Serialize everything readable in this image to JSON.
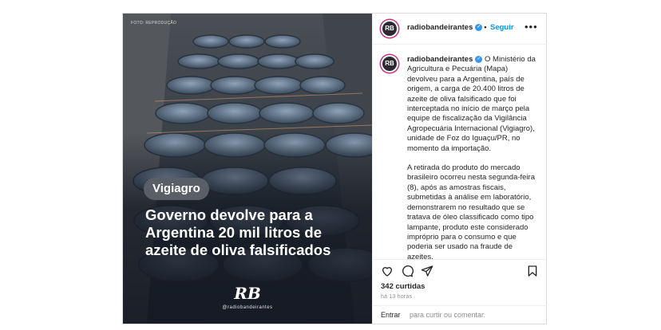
{
  "media": {
    "credit": "FOTO: REPRODUÇÃO",
    "tag": "Vigiagro",
    "headline": "Governo devolve para a Argentina 20 mil litros de azeite de oliva falsificados",
    "logo_initials": "RB",
    "logo_text": "@radiobandeirantes"
  },
  "header": {
    "avatar_initials": "RB",
    "username": "radiobandeirantes",
    "verified": "✓",
    "separator": "•",
    "follow_label": "Seguir",
    "more": "•••"
  },
  "caption": {
    "avatar_initials": "RB",
    "username": "radiobandeirantes",
    "paragraph1": "O Ministério da Agricultura e Pecuária (Mapa) devolveu para a Argentina, país de origem, a carga de 20.400 litros de azeite de oliva falsificado que foi interceptada no início de março pela equipe de fiscalização da Vigilância Agropecuária Internacional (Vigiagro), unidade de Foz do Iguaçu/PR, no momento da importação.",
    "paragraph2": "A retirada do produto do mercado brasileiro ocorreu nesta segunda-feira (8), após as amostras fiscais, submetidas à análise em laboratório, demonstrarem no resultado que se tratava de óleo classificado como tipo lampante, produto este considerado impróprio para o consumo e que poderia ser usado na fraude de azeites."
  },
  "stats": {
    "likes": "342 curtidas",
    "time": "há 13 horas"
  },
  "comment": {
    "label": "Entrar",
    "placeholder": "para curtir ou comentar."
  },
  "colors": {
    "link": "#0095f6",
    "verified": "#3897f0",
    "border": "#dbdbdb"
  },
  "icons": [
    "heart-icon",
    "comment-icon",
    "share-icon",
    "bookmark-icon"
  ]
}
